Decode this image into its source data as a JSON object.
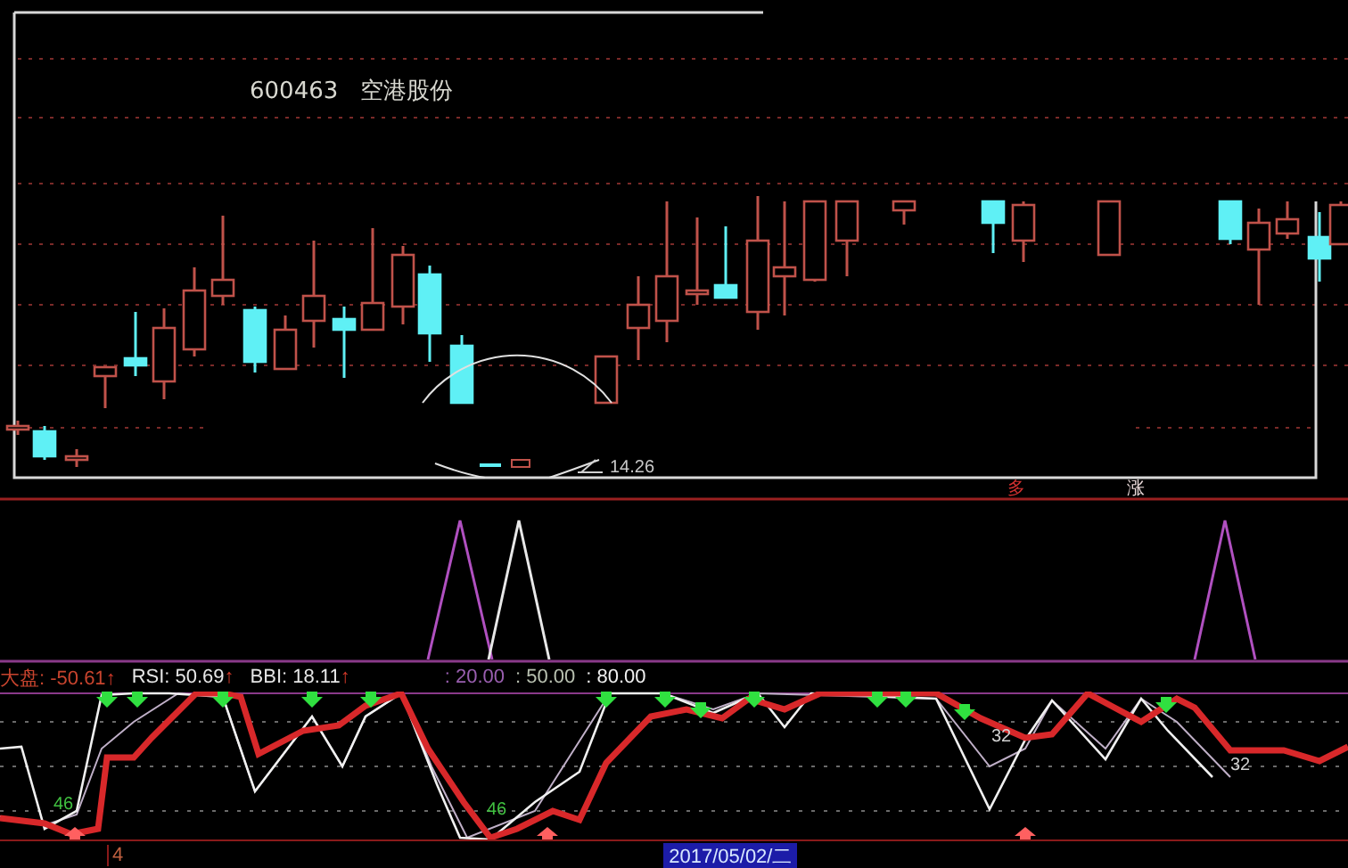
{
  "price_chart": {
    "stock_code": "600463",
    "stock_name": "空港股份",
    "price_label": "14.26",
    "axis_marks": [
      "多",
      "涨"
    ]
  },
  "indicator": {
    "readouts": [
      {
        "text": "大盘: -50.61",
        "arrow": "↑",
        "color": "#c8442e"
      },
      {
        "text": "RSI: 50.69",
        "arrow": "↑",
        "color": "#e6e6e6"
      },
      {
        "text": "BBI: 18.11",
        "arrow": "↑",
        "color": "#e6e6e6"
      }
    ],
    "levels": [
      {
        "text": ": 20.00",
        "color": "#9a5fb0"
      },
      {
        "text": ": 50.00",
        "color": "#b8c0b0"
      },
      {
        "text": ": 80.00",
        "color": "#f0f0f0"
      }
    ],
    "value_labels": [
      "46",
      "46",
      "32",
      "32"
    ]
  },
  "date_bar": {
    "index_label": "4",
    "date": "2017/05/02/二"
  }
}
